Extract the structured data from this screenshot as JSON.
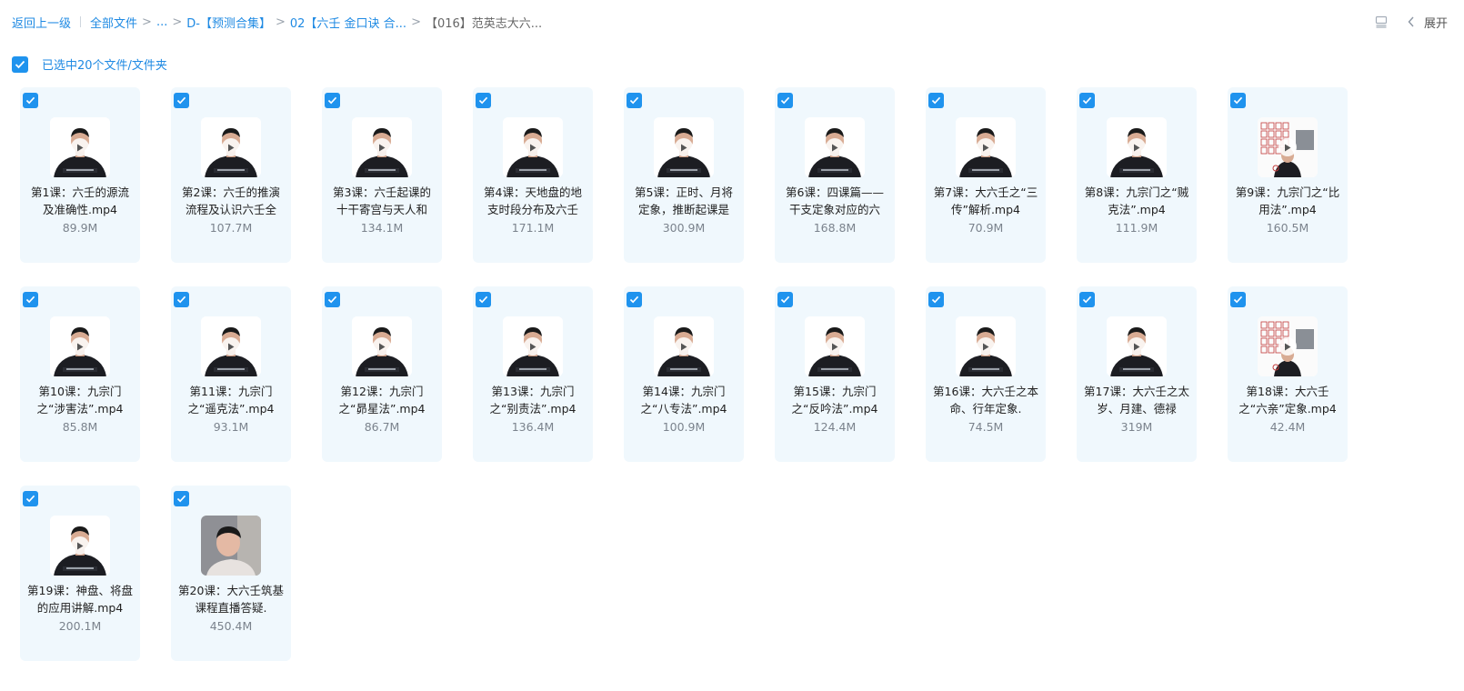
{
  "breadcrumb": {
    "back": "返回上一级",
    "all_files": "全部文件",
    "ellipsis": "...",
    "folder1": "D-【预测合集】",
    "folder2": "02【六壬 金口诀 合...",
    "current": "【016】范英志大六..."
  },
  "top_right": {
    "list_icon": "list-view-icon",
    "expand_label": "展开"
  },
  "selection": {
    "label": "已选中20个文件/文件夹",
    "checked": true
  },
  "colors": {
    "accent": "#1f93ee",
    "link": "#1f8ae3",
    "card_bg": "#f0f8fd"
  },
  "files": [
    {
      "name": "第1课：六壬的源流及准确性.mp4",
      "size": "89.9M",
      "thumb": "lecture"
    },
    {
      "name": "第2课：六壬的推演流程及认识六壬全",
      "size": "107.7M",
      "thumb": "lecture"
    },
    {
      "name": "第3课：六壬起课的十干寄宫与天人和",
      "size": "134.1M",
      "thumb": "lecture"
    },
    {
      "name": "第4课：天地盘的地支时段分布及六壬",
      "size": "171.1M",
      "thumb": "lecture"
    },
    {
      "name": "第5课：正时、月将定象，推断起课是",
      "size": "300.9M",
      "thumb": "lecture"
    },
    {
      "name": "第6课：四课篇——干支定象对应的六",
      "size": "168.8M",
      "thumb": "lecture"
    },
    {
      "name": "第7课：大六壬之“三传”解析.mp4",
      "size": "70.9M",
      "thumb": "lecture"
    },
    {
      "name": "第8课：九宗门之“贼克法”.mp4",
      "size": "111.9M",
      "thumb": "lecture"
    },
    {
      "name": "第9课：九宗门之“比用法”.mp4",
      "size": "160.5M",
      "thumb": "chart"
    },
    {
      "name": "第10课：九宗门之“涉害法”.mp4",
      "size": "85.8M",
      "thumb": "lecture"
    },
    {
      "name": "第11课：九宗门之“遥克法”.mp4",
      "size": "93.1M",
      "thumb": "lecture"
    },
    {
      "name": "第12课：九宗门之“昴星法”.mp4",
      "size": "86.7M",
      "thumb": "lecture"
    },
    {
      "name": "第13课：九宗门之“别责法”.mp4",
      "size": "136.4M",
      "thumb": "lecture"
    },
    {
      "name": "第14课：九宗门之“八专法”.mp4",
      "size": "100.9M",
      "thumb": "lecture"
    },
    {
      "name": "第15课：九宗门之“反吟法”.mp4",
      "size": "124.4M",
      "thumb": "lecture"
    },
    {
      "name": "第16课：大六壬之本命、行年定象.",
      "size": "74.5M",
      "thumb": "lecture"
    },
    {
      "name": "第17课：大六壬之太岁、月建、德禄",
      "size": "319M",
      "thumb": "lecture"
    },
    {
      "name": "第18课：大六壬之“六亲”定象.mp4",
      "size": "42.4M",
      "thumb": "chart"
    },
    {
      "name": "第19课：神盘、将盘的应用讲解.mp4",
      "size": "200.1M",
      "thumb": "lecture"
    },
    {
      "name": "第20课：大六壬筑基课程直播答疑.",
      "size": "450.4M",
      "thumb": "portrait"
    }
  ]
}
